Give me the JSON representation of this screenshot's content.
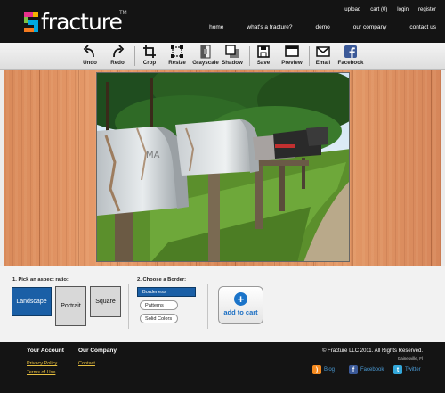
{
  "brand": {
    "logo_text": "fracture",
    "tm": "TM"
  },
  "top_links": [
    "upload",
    "cart (0)",
    "login",
    "register"
  ],
  "nav": [
    "home",
    "what's a fracture?",
    "demo",
    "our company",
    "contact us"
  ],
  "toolbar": {
    "undo": "Undo",
    "redo": "Redo",
    "crop": "Crop",
    "resize": "Resize",
    "grayscale": "Grayscale",
    "shadow": "Shadow",
    "save": "Save",
    "preview": "Preview",
    "email": "Email",
    "facebook": "Facebook"
  },
  "options": {
    "aspect_heading": "1. Pick an aspect ratio:",
    "ratios": {
      "landscape": "Landscape",
      "portrait": "Portrait",
      "square": "Square"
    },
    "selected_ratio": "Landscape",
    "border_heading": "2. Choose a Border:",
    "borders": {
      "borderless": "Borderless",
      "patterns": "Patterns",
      "solid": "Solid Colors"
    },
    "selected_border": "Borderless",
    "cart_label": "add to cart"
  },
  "footer": {
    "account_heading": "Your Account",
    "company_heading": "Our Company",
    "privacy": "Privacy Policy",
    "terms": "Terms of Use",
    "contact": "Contact",
    "copyright": "© Fracture LLC 2011. All Rights Reserved.",
    "location": "Gainesville, Fl",
    "blog": "Blog",
    "facebook": "Facebook",
    "twitter": "Twitter"
  },
  "colors": {
    "accent": "#1a5fa6",
    "header_bg": "#141414",
    "link_yellow": "#e8c040"
  }
}
